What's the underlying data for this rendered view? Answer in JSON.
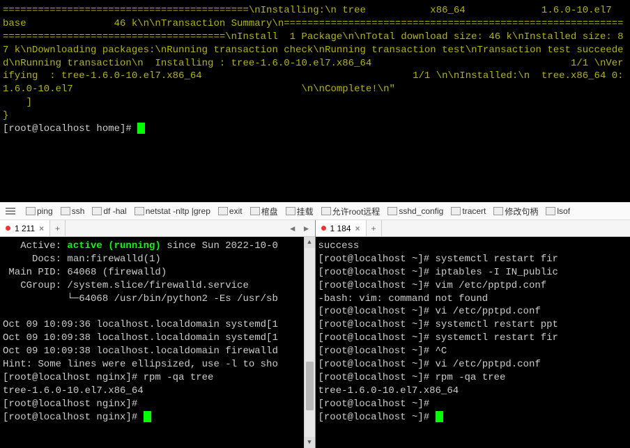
{
  "top_terminal": {
    "yellow_block": "==========================================\\nInstalling:\\n tree           x86_64             1.6.0-10.el7                  base               46 k\\n\\nTransaction Summary\\n================================================================================================\\nInstall  1 Package\\n\\nTotal download size: 46 k\\nInstalled size: 87 k\\nDownloading packages:\\nRunning transaction check\\nRunning transaction test\\nTransaction test succeeded\\nRunning transaction\\n  Installing : tree-1.6.0-10.el7.x86_64                                  1/1 \\nVerifying  : tree-1.6.0-10.el7.x86_64                                    1/1 \\n\\nInstalled:\\n  tree.x86_64 0:1.6.0-10.el7                                       \\n\\nComplete!\\n\"\n    ]\n}",
    "prompt": "[root@localhost home]# "
  },
  "toolbar": {
    "items": [
      "ping",
      "ssh",
      "df -hal",
      "netstat -nltp |grep",
      "exit",
      "棺盘",
      "挂载",
      "允许root远程",
      "sshd_config",
      "tracert",
      "修改句柄",
      "lsof"
    ]
  },
  "left_pane": {
    "tab_label": "1 211",
    "lines_pre_active": "   Active: ",
    "active_text": "active (running)",
    "lines_post_active": " since Sun 2022-10-0",
    "rest": "     Docs: man:firewalld(1)\n Main PID: 64068 (firewalld)\n   CGroup: /system.slice/firewalld.service\n           └─64068 /usr/bin/python2 -Es /usr/sb\n\nOct 09 10:09:36 localhost.localdomain systemd[1\nOct 09 10:09:38 localhost.localdomain systemd[1\nOct 09 10:09:38 localhost.localdomain firewalld\nHint: Some lines were ellipsized, use -l to sho\n[root@localhost nginx]# rpm -qa tree\ntree-1.6.0-10.el7.x86_64\n[root@localhost nginx]#\n[root@localhost nginx]# "
  },
  "right_pane": {
    "tab_label": "1 184",
    "body": "success\n[root@localhost ~]# systemctl restart fir\n[root@localhost ~]# iptables -I IN_public\n[root@localhost ~]# vim /etc/pptpd.conf\n-bash: vim: command not found\n[root@localhost ~]# vi /etc/pptpd.conf\n[root@localhost ~]# systemctl restart ppt\n[root@localhost ~]# systemctl restart fir\n[root@localhost ~]# ^C\n[root@localhost ~]# vi /etc/pptpd.conf\n[root@localhost ~]# rpm -qa tree\ntree-1.6.0-10.el7.x86_64\n[root@localhost ~]#\n[root@localhost ~]# "
  }
}
